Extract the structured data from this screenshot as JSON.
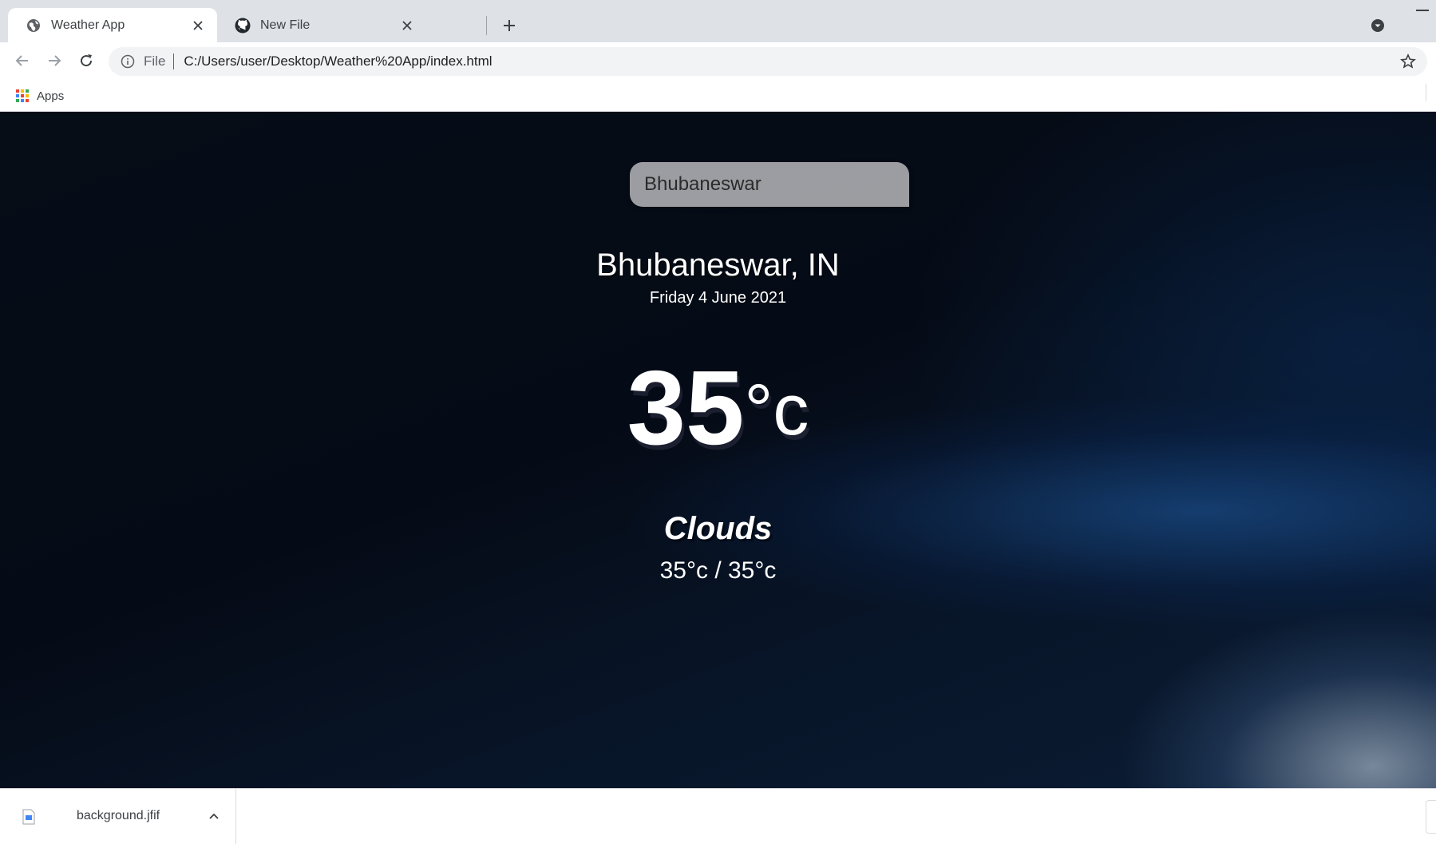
{
  "browser": {
    "tabs": [
      {
        "title": "Weather App",
        "active": true,
        "favicon": "globe-icon"
      },
      {
        "title": "New File",
        "active": false,
        "favicon": "github-icon"
      }
    ],
    "address": {
      "scheme": "File",
      "url": "C:/Users/user/Desktop/Weather%20App/index.html"
    },
    "bookmarks": {
      "apps_label": "Apps"
    }
  },
  "weather_app": {
    "search_value": "Bhubaneswar",
    "location": "Bhubaneswar, IN",
    "date": "Friday 4 June 2021",
    "temperature": "35",
    "temperature_unit": "°c",
    "condition": "Clouds",
    "hi_low": "35°c / 35°c"
  },
  "downloads": {
    "items": [
      {
        "filename": "background.jfif"
      }
    ]
  },
  "colors": {
    "tabstrip_bg": "#dee1e6",
    "omnibox_bg": "#f1f3f4",
    "content_bg": "#050b16",
    "search_box_bg": "#9a9ca1"
  }
}
